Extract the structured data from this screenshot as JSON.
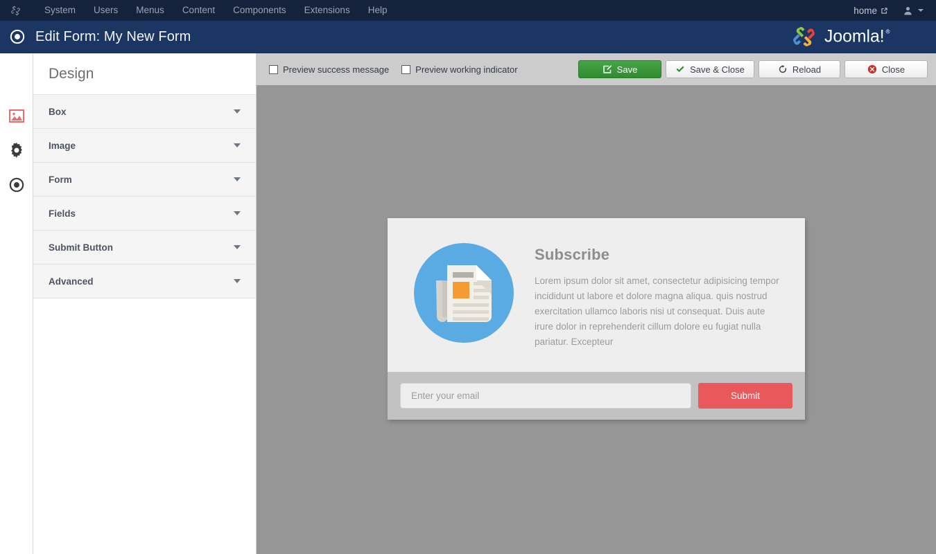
{
  "topnav": {
    "logo_icon": "joomla-mini-icon",
    "items": [
      {
        "label": "System"
      },
      {
        "label": "Menus"
      },
      {
        "label": "Users"
      },
      {
        "label": "Content"
      },
      {
        "label": "Components"
      },
      {
        "label": "Extensions"
      },
      {
        "label": "Help"
      }
    ],
    "menu_order": [
      "System",
      "Users",
      "Menus",
      "Content",
      "Components",
      "Extensions",
      "Help"
    ],
    "home_label": "home",
    "home_icon": "external-link-icon",
    "user_icon": "user-avatar-icon",
    "user_caret_icon": "chevron-down-icon"
  },
  "subheader": {
    "icon": "target-icon",
    "title": "Edit Form: My New Form",
    "brand_name": "Joomla!",
    "brand_mark": "joomla-logo-icon",
    "brand_trademark": "®"
  },
  "rail": {
    "items": [
      {
        "name": "image",
        "icon": "image-icon",
        "color": "#ea6a6d"
      },
      {
        "name": "settings",
        "icon": "gear-icon",
        "color": "#3b3b3b"
      },
      {
        "name": "target",
        "icon": "target-icon",
        "color": "#3b3b3b"
      }
    ]
  },
  "sidebar": {
    "title": "Design",
    "sections": [
      {
        "label": "Box",
        "caret": "chevron-down-icon",
        "expanded": false
      },
      {
        "label": "Image",
        "caret": "chevron-down-icon",
        "expanded": false
      },
      {
        "label": "Form",
        "caret": "chevron-down-icon",
        "expanded": false
      },
      {
        "label": "Fields",
        "caret": "chevron-down-icon",
        "expanded": false
      },
      {
        "label": "Submit Button",
        "caret": "chevron-down-icon",
        "expanded": false
      },
      {
        "label": "Advanced",
        "caret": "chevron-down-icon",
        "expanded": false
      }
    ]
  },
  "toolbar": {
    "checkboxes": [
      {
        "label": "Preview success message",
        "checked": false
      },
      {
        "label": "Preview working indicator",
        "checked": false
      }
    ],
    "buttons": [
      {
        "label": "Save",
        "icon": "edit-pencil-icon",
        "style": "primary"
      },
      {
        "label": "Save & Close",
        "icon": "check-icon",
        "style": "default"
      },
      {
        "label": "Reload",
        "icon": "reload-icon",
        "style": "default"
      },
      {
        "label": "Close",
        "icon": "close-circle-icon",
        "style": "default"
      }
    ]
  },
  "preview": {
    "card": {
      "illustration_icon": "newspaper-icon",
      "heading": "Subscribe",
      "body": "Lorem ipsum dolor sit amet, consectetur adipisicing tempor incididunt ut labore et dolore magna aliqua. quis nostrud exercitation ullamco laboris nisi ut consequat. Duis aute irure dolor in reprehenderit cillum dolore eu fugiat nulla pariatur. Excepteur",
      "email_placeholder": "Enter your email",
      "email_value": "",
      "submit_label": "Submit"
    }
  },
  "colors": {
    "topnav_bg": "#14223c",
    "subheader_bg": "#1c3664",
    "canvas_bg": "#969696",
    "toolbar_bg": "#cccccc",
    "save_green": "#2f8b30",
    "submit_red": "#e9595b",
    "circle_blue": "#5aabe4",
    "accent_orange": "#f49b33"
  }
}
